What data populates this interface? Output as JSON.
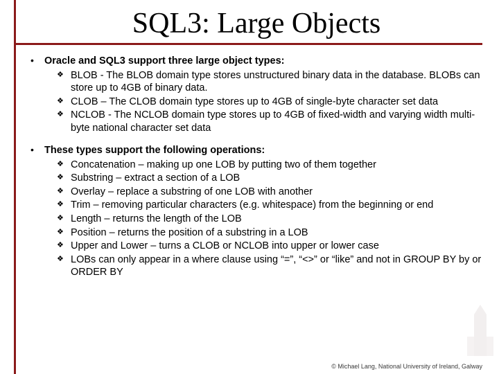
{
  "title": "SQL3: Large Objects",
  "sections": [
    {
      "heading": "Oracle and SQL3 support three large object types:",
      "items": [
        "BLOB - The BLOB domain type stores unstructured binary data in the database. BLOBs can store up to 4GB of binary data.",
        "CLOB – The CLOB domain type stores up to 4GB of single-byte character set data",
        "NCLOB - The NCLOB domain type stores up to 4GB of fixed-width and varying width multi-byte national character set data"
      ]
    },
    {
      "heading": "These types support the following operations:",
      "items": [
        "Concatenation – making up one LOB by putting two of them together",
        "Substring – extract a section of a LOB",
        "Overlay – replace a substring of one LOB with another",
        "Trim – removing particular characters (e.g. whitespace) from the beginning or end",
        "Length – returns the length of the LOB",
        "Position – returns the position of a substring in a LOB",
        "Upper and Lower – turns a CLOB or NCLOB into upper or lower case",
        "LOBs can only appear in a where clause using “=”, “<>” or “like” and not in GROUP BY by or ORDER BY"
      ]
    }
  ],
  "footer": "© Michael Lang, National University of Ireland, Galway",
  "bullets": {
    "l1": "•",
    "l2": "❖"
  }
}
